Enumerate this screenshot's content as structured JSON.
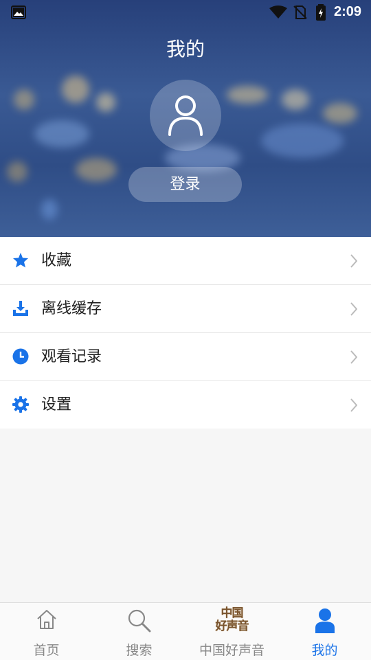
{
  "status_bar": {
    "time": "2:09",
    "icons": [
      "image-icon",
      "wifi-icon",
      "no-sim-icon",
      "battery-charging-icon"
    ]
  },
  "header": {
    "title": "我的",
    "avatar_icon": "user-outline-icon",
    "login_label": "登录"
  },
  "menu": {
    "items": [
      {
        "label": "收藏",
        "icon": "star-icon"
      },
      {
        "label": "离线缓存",
        "icon": "download-icon"
      },
      {
        "label": "观看记录",
        "icon": "clock-icon"
      },
      {
        "label": "设置",
        "icon": "gear-icon"
      }
    ],
    "accent_color": "#1a73e8"
  },
  "tabbar": {
    "tabs": [
      {
        "label": "首页",
        "icon": "home-icon",
        "active": false
      },
      {
        "label": "搜索",
        "icon": "search-icon",
        "active": false
      },
      {
        "label": "中国好声音",
        "icon": "show-logo-icon",
        "active": false,
        "logo_text": [
          "中国",
          "好声音"
        ]
      },
      {
        "label": "我的",
        "icon": "user-filled-icon",
        "active": true
      }
    ],
    "active_color": "#1a73e8",
    "inactive_color": "#888888"
  }
}
